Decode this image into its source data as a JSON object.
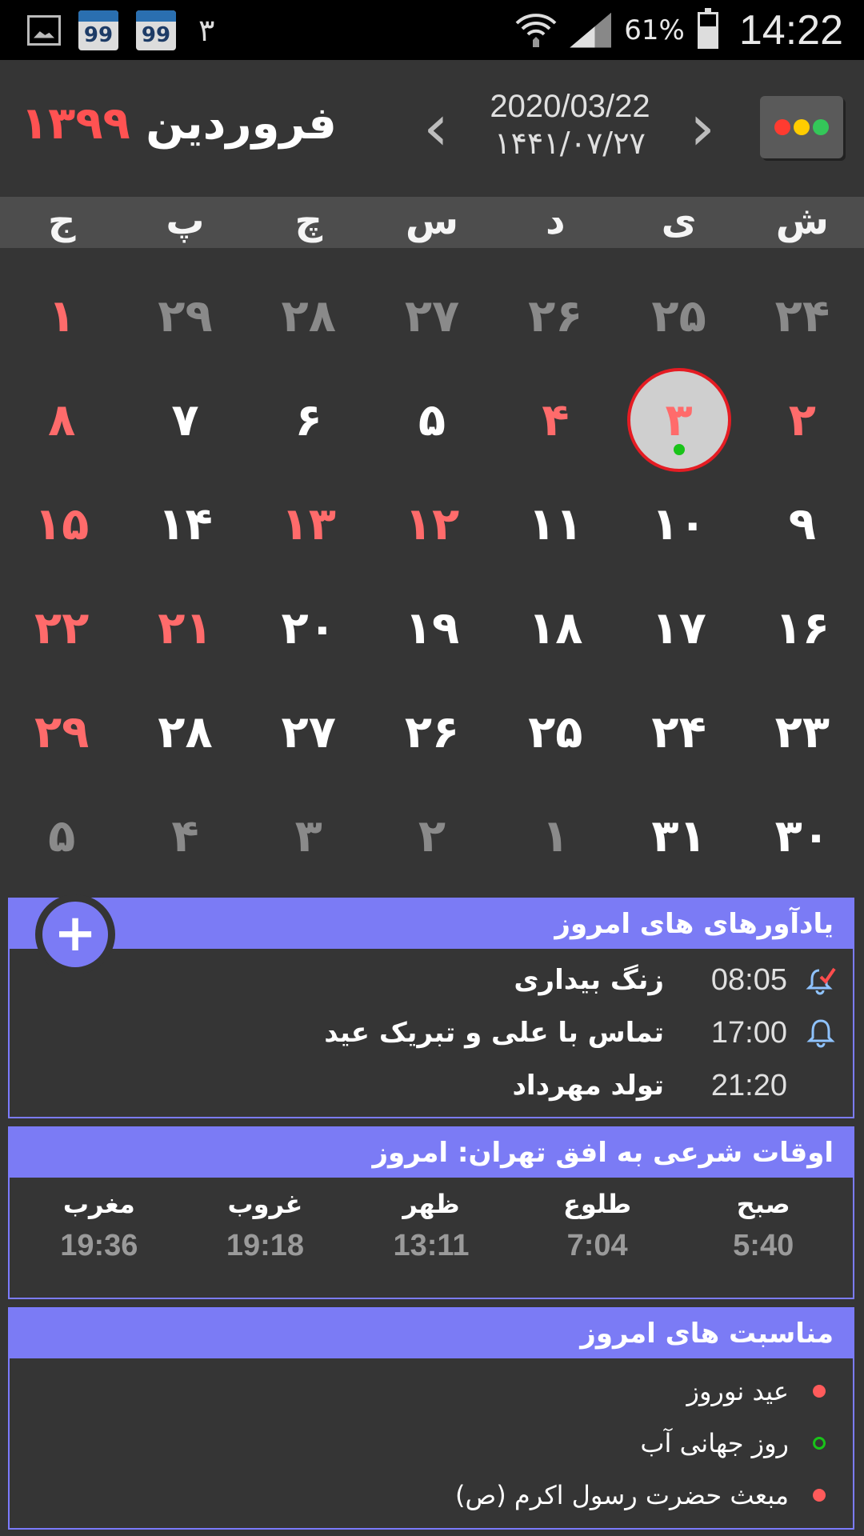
{
  "status_bar": {
    "notification_count": "۳",
    "calendar_badge": "99",
    "battery_percent": "61%",
    "battery_level": 0.61,
    "time": "14:22"
  },
  "header": {
    "month": "فروردین",
    "year": "۱۳۹۹",
    "gregorian_date": "2020/03/22",
    "hijri_date": "۱۴۴۱/۰۷/۲۷",
    "prev_arrow": "‹",
    "next_arrow": "›",
    "menu_dot_colors": [
      "#ff3b30",
      "#ffcc00",
      "#34c759"
    ]
  },
  "weekdays": [
    "ش",
    "ی",
    "د",
    "س",
    "چ",
    "پ",
    "ج"
  ],
  "weeks": [
    [
      {
        "d": "۲۴",
        "s": "dim"
      },
      {
        "d": "۲۵",
        "s": "dim"
      },
      {
        "d": "۲۶",
        "s": "dim"
      },
      {
        "d": "۲۷",
        "s": "dim"
      },
      {
        "d": "۲۸",
        "s": "dim"
      },
      {
        "d": "۲۹",
        "s": "dim"
      },
      {
        "d": "۱",
        "s": "hol"
      }
    ],
    [
      {
        "d": "۲",
        "s": "hol"
      },
      {
        "d": "۳",
        "s": "today"
      },
      {
        "d": "۴",
        "s": "hol"
      },
      {
        "d": "۵",
        "s": ""
      },
      {
        "d": "۶",
        "s": ""
      },
      {
        "d": "۷",
        "s": ""
      },
      {
        "d": "۸",
        "s": "hol"
      }
    ],
    [
      {
        "d": "۹",
        "s": ""
      },
      {
        "d": "۱۰",
        "s": ""
      },
      {
        "d": "۱۱",
        "s": ""
      },
      {
        "d": "۱۲",
        "s": "hol"
      },
      {
        "d": "۱۳",
        "s": "hol"
      },
      {
        "d": "۱۴",
        "s": ""
      },
      {
        "d": "۱۵",
        "s": "hol"
      }
    ],
    [
      {
        "d": "۱۶",
        "s": ""
      },
      {
        "d": "۱۷",
        "s": ""
      },
      {
        "d": "۱۸",
        "s": ""
      },
      {
        "d": "۱۹",
        "s": ""
      },
      {
        "d": "۲۰",
        "s": ""
      },
      {
        "d": "۲۱",
        "s": "hol"
      },
      {
        "d": "۲۲",
        "s": "hol"
      }
    ],
    [
      {
        "d": "۲۳",
        "s": ""
      },
      {
        "d": "۲۴",
        "s": ""
      },
      {
        "d": "۲۵",
        "s": ""
      },
      {
        "d": "۲۶",
        "s": ""
      },
      {
        "d": "۲۷",
        "s": ""
      },
      {
        "d": "۲۸",
        "s": ""
      },
      {
        "d": "۲۹",
        "s": "hol"
      }
    ],
    [
      {
        "d": "۳۰",
        "s": ""
      },
      {
        "d": "۳۱",
        "s": ""
      },
      {
        "d": "۱",
        "s": "dim"
      },
      {
        "d": "۲",
        "s": "dim"
      },
      {
        "d": "۳",
        "s": "dim"
      },
      {
        "d": "۴",
        "s": "dim"
      },
      {
        "d": "۵",
        "s": "dim"
      }
    ]
  ],
  "reminders": {
    "title": "یادآورهای های امروز",
    "add_label": "+",
    "items": [
      {
        "time": "08:05",
        "text": "زنگ بیداری",
        "icon": "alarm-check-icon"
      },
      {
        "time": "17:00",
        "text": "تماس با علی و تبریک عید",
        "icon": "bell-icon"
      },
      {
        "time": "21:20",
        "text": "تولد مهرداد",
        "icon": ""
      }
    ]
  },
  "prayer_times": {
    "title": "اوقات شرعی به افق تهران:  امروز",
    "items": [
      {
        "label": "صبح",
        "time": "5:40"
      },
      {
        "label": "طلوع",
        "time": "7:04"
      },
      {
        "label": "ظهر",
        "time": "13:11"
      },
      {
        "label": "غروب",
        "time": "19:18"
      },
      {
        "label": "مغرب",
        "time": "19:36"
      }
    ]
  },
  "occasions": {
    "title": "مناسبت های امروز",
    "items": [
      {
        "text": "عید نوروز",
        "marker": "filled",
        "color": "#ff5b5b"
      },
      {
        "text": "روز جهانی آب",
        "marker": "hollow",
        "color": "#19c319"
      },
      {
        "text": "مبعث حضرت رسول اکرم (ص)",
        "marker": "filled",
        "color": "#ff5b5b"
      }
    ]
  }
}
